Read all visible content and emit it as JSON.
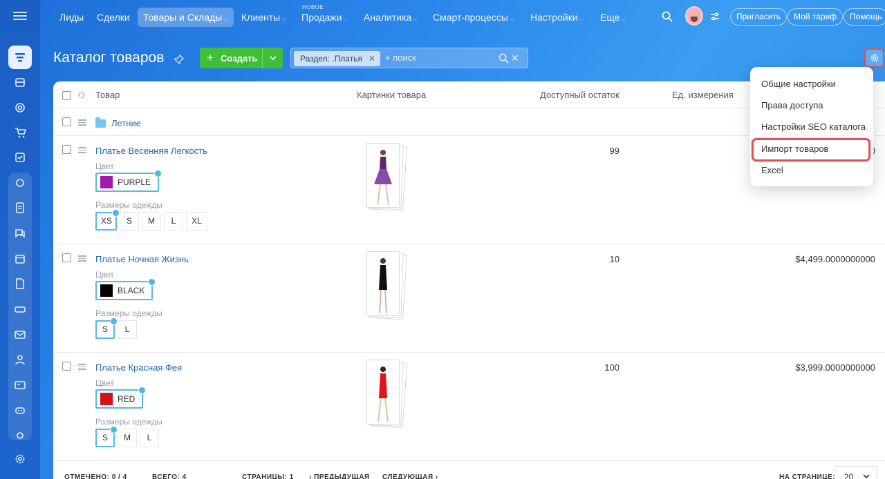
{
  "nav": {
    "items": [
      {
        "label": "Лиды",
        "chevron": false
      },
      {
        "label": "Сделки",
        "chevron": false
      },
      {
        "label": "Товары и Склады",
        "chevron": true
      },
      {
        "label": "Клиенты",
        "chevron": true
      },
      {
        "label": "Продажи",
        "chevron": true,
        "badge": "НОВОЕ"
      },
      {
        "label": "Аналитика",
        "chevron": true
      },
      {
        "label": "Смарт-процессы",
        "chevron": true
      },
      {
        "label": "Настройки",
        "chevron": true
      },
      {
        "label": "Еще",
        "chevron": true
      }
    ],
    "invite": "Пригласить",
    "tariff": "Мой тариф",
    "help": "Помощь"
  },
  "page": {
    "title": "Каталог товаров",
    "create": "Создать",
    "filter_chip": "Раздел: .Платья",
    "search_placeholder": "+ поиск"
  },
  "table": {
    "headers": [
      "Товар",
      "Картинки товара",
      "Доступный остаток",
      "Ед. измерения"
    ],
    "folder": "Летние",
    "color_label": "Цвет",
    "sizes_label": "Размеры одежды",
    "rows": [
      {
        "name": "Платье Весенняя Легкость",
        "color": "PURPLE",
        "swatch": "#a21ba8",
        "sizes": [
          "XS",
          "S",
          "M",
          "L",
          "XL"
        ],
        "selected_size": "XS",
        "stock": "99",
        "price": "0"
      },
      {
        "name": "Платье Ночная Жизнь",
        "color": "BLACK",
        "swatch": "#000000",
        "sizes": [
          "S",
          "L"
        ],
        "selected_size": "S",
        "stock": "10",
        "price": "$4,499.0000000000"
      },
      {
        "name": "Платье Красная Фея",
        "color": "RED",
        "swatch": "#d0141c",
        "sizes": [
          "S",
          "M",
          "L"
        ],
        "selected_size": "S",
        "stock": "100",
        "price": "$3,999.0000000000"
      }
    ]
  },
  "footer": {
    "marked": "ОТМЕЧЕНО: 0 / 4",
    "total": "ВСЕГО: 4",
    "pages": "СТРАНИЦЫ: 1",
    "prev": "‹ ПРЕДЫДУЩАЯ",
    "next": "СЛЕДУЮЩАЯ ›",
    "per_page_label": "НА СТРАНИЦЕ:",
    "per_page": "20"
  },
  "menu": {
    "items": [
      "Общие настройки",
      "Права доступа",
      "Настройки SEO каталога",
      "Импорт товаров",
      "Excel"
    ]
  },
  "colors": {
    "accent": "#3fbf37",
    "highlight": "#e15059",
    "link": "#2067b0"
  }
}
